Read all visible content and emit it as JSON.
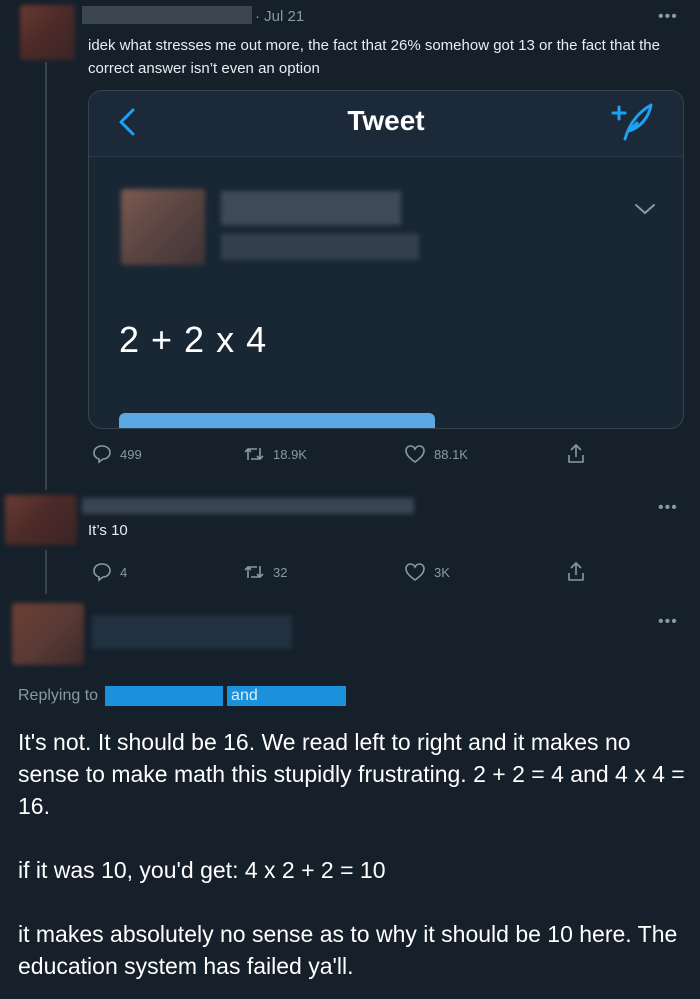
{
  "tweet1": {
    "date": "· Jul 21",
    "text": "idek what stresses me out more, the fact that 26% somehow got 13 or the fact that the correct answer isn’t even an option",
    "quoted": {
      "nav_title": "Tweet",
      "content": "2 + 2 x 4"
    },
    "stats": {
      "replies": "499",
      "retweets": "18.9K",
      "likes": "88.1K"
    }
  },
  "tweet2": {
    "text": "It’s 10",
    "stats": {
      "replies": "4",
      "retweets": "32",
      "likes": "3K"
    }
  },
  "tweet3": {
    "replying_label": "Replying to",
    "replying_and": "and",
    "paragraphs": [
      "It's not. It should be 16. We read left to right and it makes no sense to make math this stupidly frustrating. 2 + 2 = 4 and 4 x 4 = 16.",
      "if it was 10, you'd get: 4 x 2 + 2 = 10",
      "it makes absolutely no sense as to why it should be 10 here. The education system has failed ya'll."
    ]
  },
  "colors": {
    "background": "#15202b",
    "accent": "#1da1f2",
    "muted": "#8899a6"
  }
}
